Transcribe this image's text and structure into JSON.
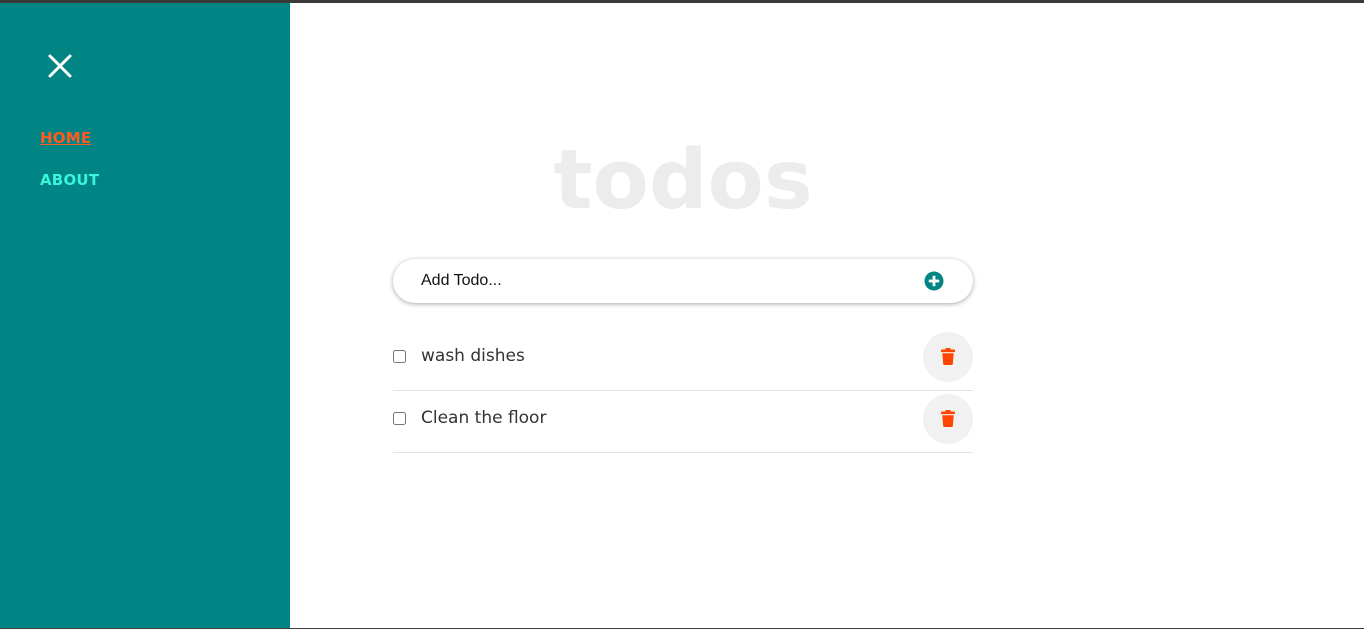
{
  "sidebar": {
    "close_icon": "close-icon",
    "nav": [
      {
        "label": "HOME",
        "active": true
      },
      {
        "label": "ABOUT",
        "active": false
      }
    ],
    "colors": {
      "background": "#008584",
      "active": "#ff5a1f",
      "link": "#3af5d9"
    }
  },
  "main": {
    "title": "todos",
    "add_todo": {
      "placeholder": "Add Todo...",
      "value": "",
      "icon": "plus-circle-icon"
    },
    "todos": [
      {
        "text": "wash dishes",
        "done": false
      },
      {
        "text": "Clean the floor",
        "done": false
      }
    ],
    "delete_icon": "trash-icon",
    "colors": {
      "accent": "#008584",
      "delete": "#ff4500"
    }
  }
}
